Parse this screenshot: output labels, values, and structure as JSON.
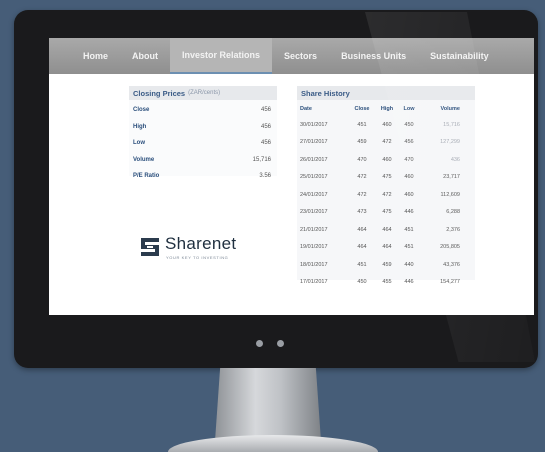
{
  "nav": {
    "items": [
      "Home",
      "About",
      "Investor Relations",
      "Sectors",
      "Business Units",
      "Sustainability"
    ],
    "active_index": 2
  },
  "closing_prices": {
    "title": "Closing Prices",
    "subtitle": "(ZAR/cents)",
    "rows": [
      {
        "label": "Close",
        "value": "456"
      },
      {
        "label": "High",
        "value": "456"
      },
      {
        "label": "Low",
        "value": "456"
      },
      {
        "label": "Volume",
        "value": "15,716"
      },
      {
        "label": "P/E Ratio",
        "value": "3.56"
      }
    ]
  },
  "share_history": {
    "title": "Share History",
    "columns": [
      "Date",
      "Close",
      "High",
      "Low",
      "Volume"
    ],
    "rows": [
      [
        "30/01/2017",
        "451",
        "460",
        "450",
        "15,716"
      ],
      [
        "27/01/2017",
        "459",
        "472",
        "456",
        "127,299"
      ],
      [
        "26/01/2017",
        "470",
        "460",
        "470",
        "436"
      ],
      [
        "25/01/2017",
        "472",
        "475",
        "460",
        "23,717"
      ],
      [
        "24/01/2017",
        "472",
        "472",
        "460",
        "112,609"
      ],
      [
        "23/01/2017",
        "473",
        "475",
        "446",
        "6,288"
      ],
      [
        "21/01/2017",
        "464",
        "464",
        "451",
        "2,376"
      ],
      [
        "19/01/2017",
        "464",
        "464",
        "451",
        "205,805"
      ],
      [
        "18/01/2017",
        "451",
        "459",
        "440",
        "43,376"
      ],
      [
        "17/01/2017",
        "450",
        "455",
        "446",
        "154,277"
      ]
    ]
  },
  "logo": {
    "name": "Sharenet",
    "tagline": "YOUR KEY TO INVESTING"
  },
  "colors": {
    "background": "#465d78",
    "accent": "#3a5b86",
    "nav": "#9a9a9a"
  }
}
